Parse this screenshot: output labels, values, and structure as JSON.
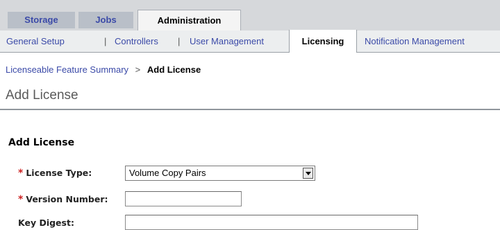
{
  "top_tabs": [
    {
      "label": "Storage",
      "active": false
    },
    {
      "label": "Jobs",
      "active": false
    },
    {
      "label": "Administration",
      "active": true
    }
  ],
  "sub_tabs": {
    "items": [
      {
        "label": "General Setup",
        "active": false
      },
      {
        "label": "Controllers",
        "active": false
      },
      {
        "label": "User Management",
        "active": false
      },
      {
        "label": "Licensing",
        "active": true
      },
      {
        "label": "Notification Management",
        "active": false
      }
    ],
    "separator": "|"
  },
  "breadcrumb": {
    "parent": "Licenseable Feature Summary",
    "separator": ">",
    "current": "Add License"
  },
  "page_title": "Add License",
  "form": {
    "section_title": "Add License",
    "required_marker": "*",
    "license_type": {
      "label": "License Type:",
      "value": "Volume Copy Pairs"
    },
    "version_number": {
      "label": "Version Number:",
      "value": ""
    },
    "key_digest": {
      "label": "Key Digest:",
      "value": ""
    }
  },
  "colors": {
    "link": "#3b4aa8",
    "required": "#cc2222",
    "tab_band": "#d6d8db",
    "inactive_tab": "#b9bfc8"
  }
}
